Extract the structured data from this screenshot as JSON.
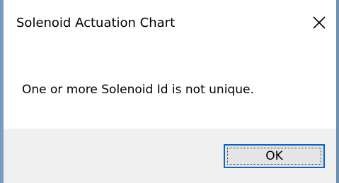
{
  "dialog": {
    "title": "Solenoid Actuation Chart",
    "message": "One or more Solenoid Id is not unique.",
    "ok_label": "OK",
    "close_icon": "close-icon"
  },
  "colors": {
    "dialog_background": "#ffffff",
    "footer_background": "#f0f0f0",
    "button_focus_border": "#0a63c9",
    "desktop_edge": "#6d8fb0"
  }
}
